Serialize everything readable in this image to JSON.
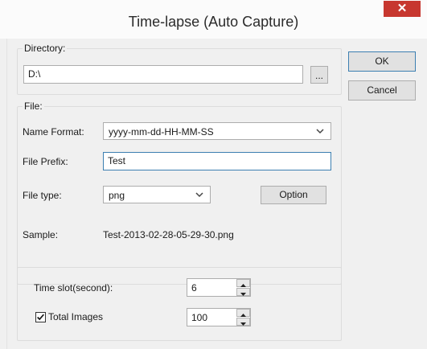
{
  "window": {
    "title": "Time-lapse (Auto Capture)",
    "close_glyph": "✕"
  },
  "directory": {
    "legend": "Directory:",
    "value": "D:\\",
    "browse_label": "..."
  },
  "file": {
    "legend": "File:",
    "name_format_label": "Name Format:",
    "name_format_value": "yyyy-mm-dd-HH-MM-SS",
    "prefix_label": "File Prefix:",
    "prefix_value": "Test",
    "type_label": "File type:",
    "type_value": "png",
    "option_label": "Option",
    "sample_label": "Sample:",
    "sample_value": "Test-2013-02-28-05-29-30.png"
  },
  "timing": {
    "slot_label": "Time slot(second):",
    "slot_value": "6",
    "total_label": "Total Images",
    "total_checked": true,
    "total_value": "100"
  },
  "actions": {
    "ok_label": "OK",
    "cancel_label": "Cancel"
  },
  "colors": {
    "close_red": "#c7372f",
    "focus_blue": "#3c7fb1"
  }
}
